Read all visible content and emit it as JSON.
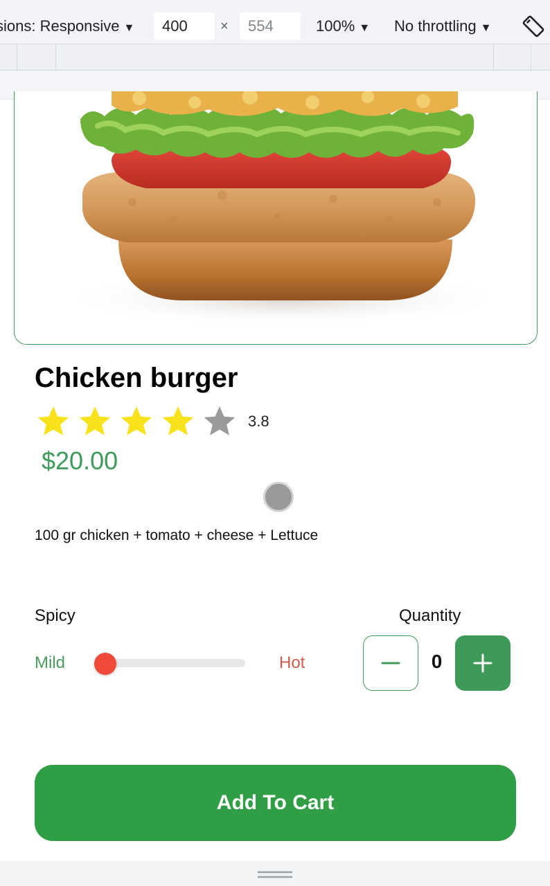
{
  "devtools": {
    "dimensions_label": "sions: Responsive",
    "width_value": "400",
    "height_value": "554",
    "times_symbol": "×",
    "zoom": "100%",
    "throttling": "No throttling",
    "caret": "▼"
  },
  "product": {
    "image_icon": "burger-image",
    "title": "Chicken burger",
    "rating": 3.8,
    "rating_text": "3.8",
    "stars_filled": 4,
    "stars_total": 5,
    "price": "$20.00",
    "description": "100 gr chicken + tomato + cheese + Lettuce"
  },
  "spicy": {
    "label": "Spicy",
    "min_label": "Mild",
    "max_label": "Hot",
    "level": 0
  },
  "quantity": {
    "label": "Quantity",
    "value": "0",
    "minus_icon": "minus-icon",
    "plus_icon": "plus-icon"
  },
  "cart": {
    "button_label": "Add To Cart"
  },
  "colors": {
    "accent_green": "#2f9e44",
    "price_green": "#3f9b5a",
    "spicy_red": "#f04a3a",
    "star_yellow": "#f7e21b",
    "star_gray": "#9a9a9a"
  }
}
